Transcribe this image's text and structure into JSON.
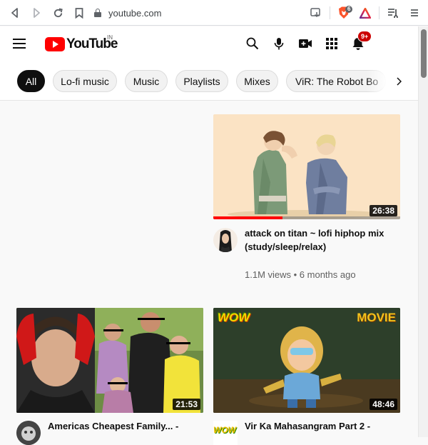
{
  "browser": {
    "url": "youtube.com",
    "brave_badge": "6"
  },
  "youtube": {
    "logo_text": "YouTube",
    "country_code": "IN",
    "notification_count": "9+"
  },
  "chips": [
    {
      "label": "All",
      "active": true
    },
    {
      "label": "Lo-fi music"
    },
    {
      "label": "Music"
    },
    {
      "label": "Playlists"
    },
    {
      "label": "Mixes"
    },
    {
      "label": "ViR: The Robot Bo"
    }
  ],
  "videos": [
    {
      "title": "attack on titan ~ lofi hiphop mix (study/sleep/relax)",
      "meta": "1.1M views • 6 months ago",
      "duration": "26:38",
      "watched_fraction": 0.37
    },
    {
      "title": "Americas Cheapest Family... -",
      "duration": "21:53"
    },
    {
      "title": "Vir Ka Mahasangram Part 2 -",
      "duration": "48:46",
      "thumb_badge_left": "WOW",
      "thumb_badge_right": "MOVIE",
      "channel_logo": "WOW"
    }
  ],
  "colors": {
    "brand_red": "#ff0000",
    "chip_active_bg": "#0f0f0f",
    "badge_red": "#cc0000"
  },
  "icons": [
    "back-icon",
    "forward-icon",
    "reload-icon",
    "bookmark-icon",
    "lock-icon",
    "install-icon",
    "brave-shield-icon",
    "brave-rewards-icon",
    "playlist-icon",
    "menu-icon",
    "search-icon",
    "mic-icon",
    "create-video-icon",
    "apps-icon",
    "bell-icon",
    "chevron-right-icon"
  ]
}
